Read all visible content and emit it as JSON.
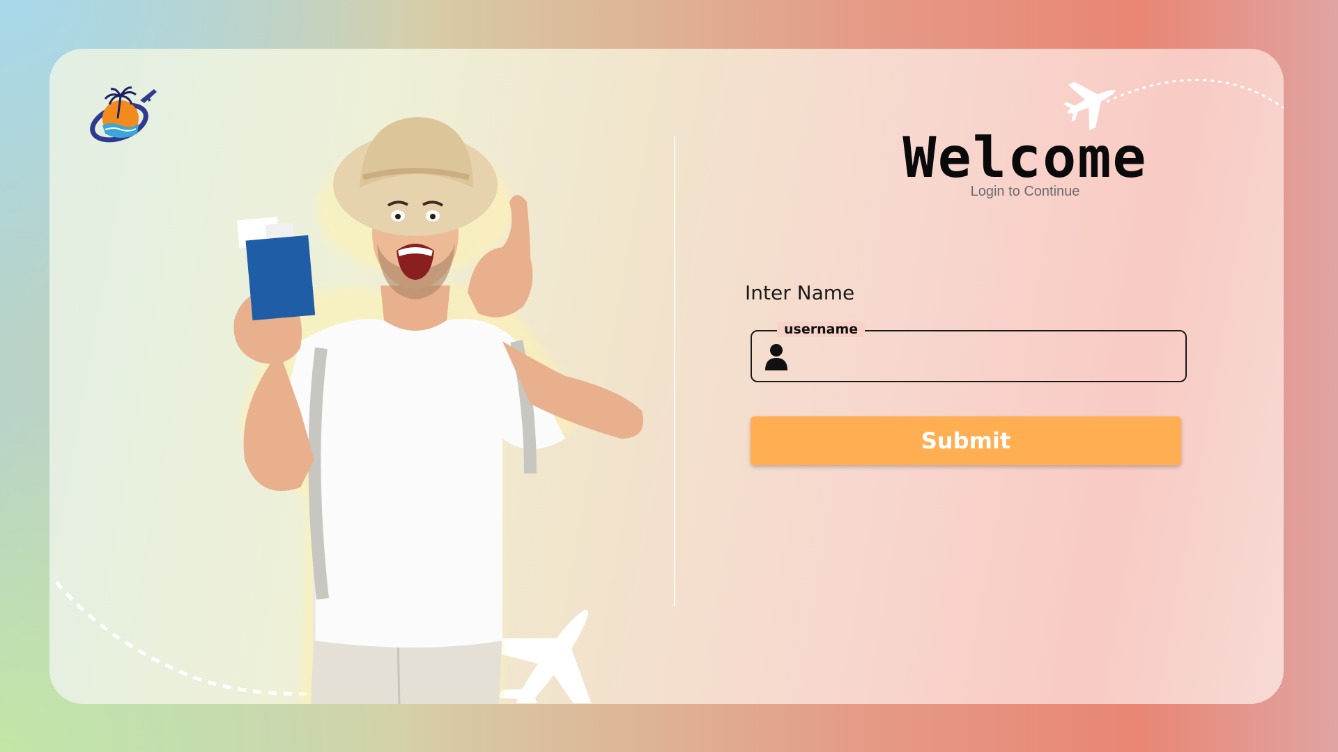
{
  "header": {
    "title": "Welcome",
    "subtitle": "Login to Continue"
  },
  "form": {
    "field_label": "Inter Name",
    "input_legend": "username",
    "input_value": "",
    "input_placeholder": "",
    "submit_label": "Submit"
  },
  "icons": {
    "logo": "travel-logo-icon",
    "user": "user-icon",
    "plane_top": "airplane-icon",
    "plane_bottom": "airplane-icon"
  },
  "colors": {
    "submit_bg": "#ffae51",
    "submit_text": "#ffffff",
    "title": "#0a0a0a",
    "subtitle": "#6b6b6b"
  }
}
